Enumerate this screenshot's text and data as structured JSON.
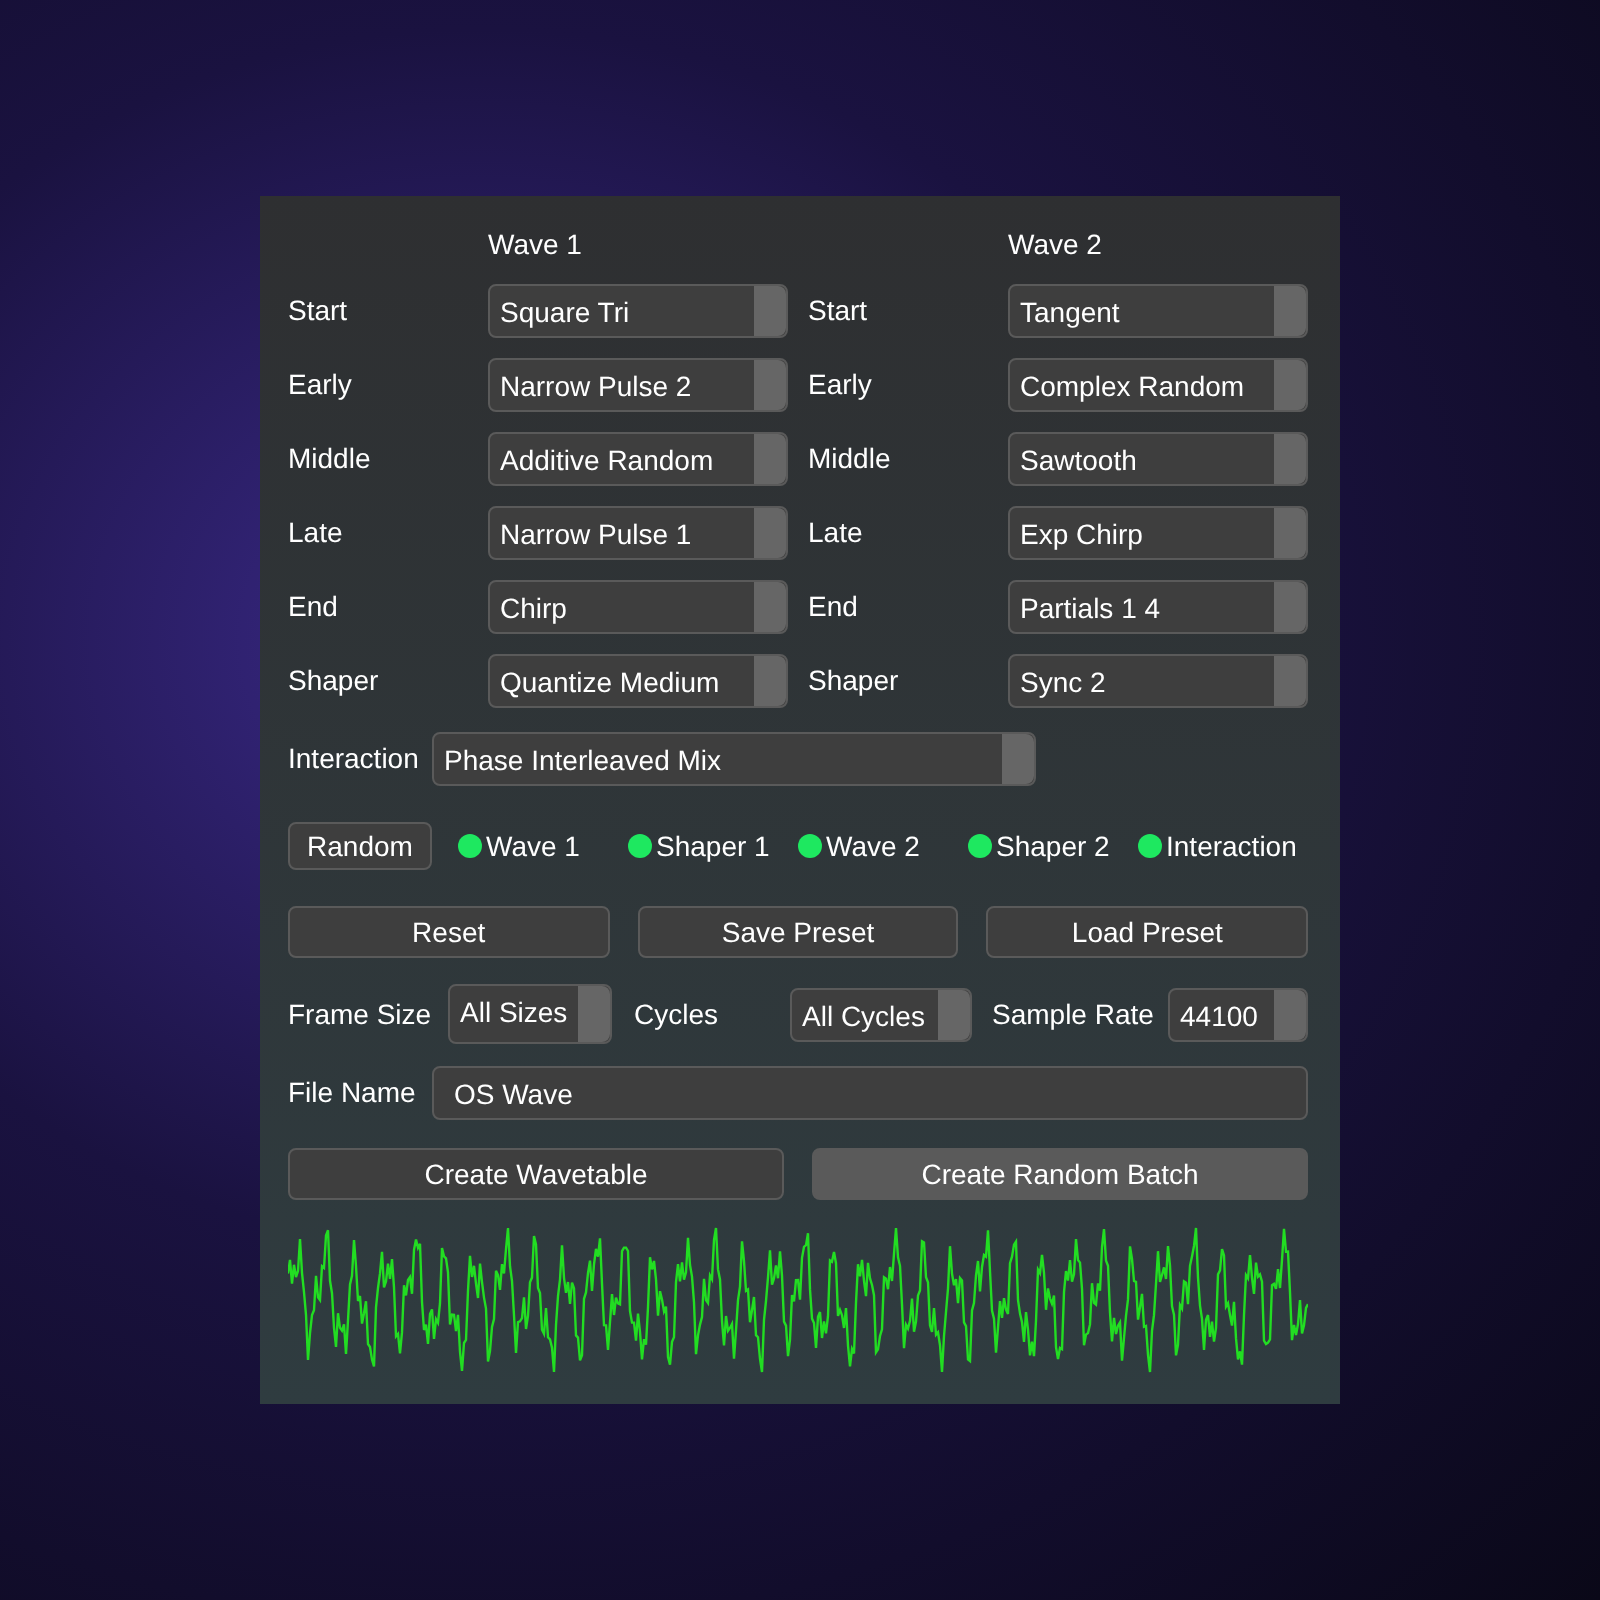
{
  "waves": [
    {
      "header": "Wave 1",
      "rows": [
        {
          "label": "Start",
          "value": "Square Tri"
        },
        {
          "label": "Early",
          "value": "Narrow Pulse 2"
        },
        {
          "label": "Middle",
          "value": "Additive Random"
        },
        {
          "label": "Late",
          "value": "Narrow Pulse 1"
        },
        {
          "label": "End",
          "value": "Chirp"
        },
        {
          "label": "Shaper",
          "value": "Quantize Medium"
        }
      ]
    },
    {
      "header": "Wave 2",
      "rows": [
        {
          "label": "Start",
          "value": "Tangent"
        },
        {
          "label": "Early",
          "value": "Complex Random"
        },
        {
          "label": "Middle",
          "value": "Sawtooth"
        },
        {
          "label": "Late",
          "value": "Exp Chirp"
        },
        {
          "label": "End",
          "value": "Partials 1 4"
        },
        {
          "label": "Shaper",
          "value": "Sync 2"
        }
      ]
    }
  ],
  "interaction": {
    "label": "Interaction",
    "value": "Phase Interleaved Mix"
  },
  "random_button": "Random",
  "toggles": [
    {
      "label": "Wave 1",
      "on": true
    },
    {
      "label": "Shaper 1",
      "on": true
    },
    {
      "label": "Wave 2",
      "on": true
    },
    {
      "label": "Shaper 2",
      "on": true
    },
    {
      "label": "Interaction",
      "on": true
    }
  ],
  "preset_buttons": [
    {
      "label": "Reset",
      "highlighted": false
    },
    {
      "label": "Save Preset",
      "highlighted": false
    },
    {
      "label": "Load Preset",
      "highlighted": false
    }
  ],
  "settings": [
    {
      "label": "Frame Size",
      "value": "All Sizes"
    },
    {
      "label": "Cycles",
      "value": "All Cycles"
    },
    {
      "label": "Sample Rate",
      "value": "44100"
    }
  ],
  "file_name": {
    "label": "File Name",
    "value": "OS Wave"
  },
  "create_buttons": [
    {
      "label": "Create Wavetable",
      "highlighted": false
    },
    {
      "label": "Create Random Batch",
      "highlighted": true
    }
  ]
}
